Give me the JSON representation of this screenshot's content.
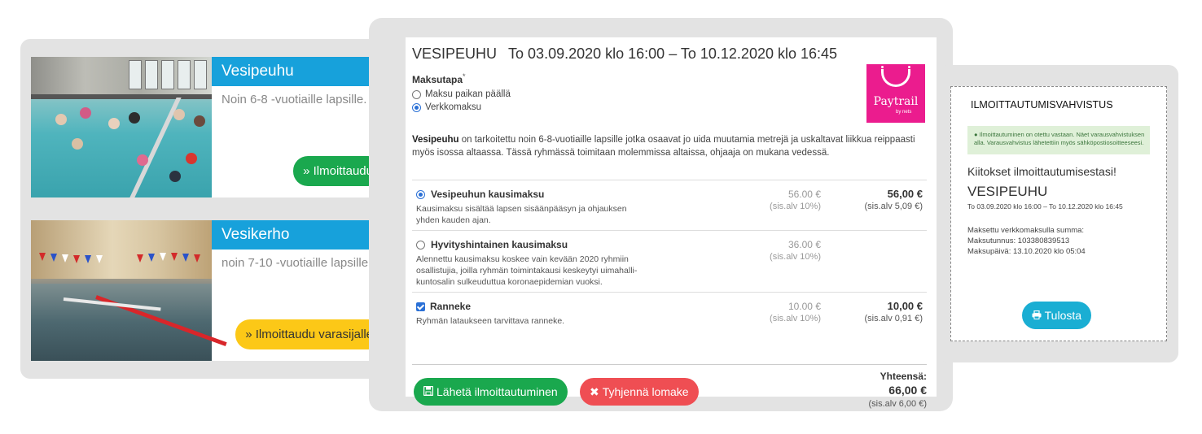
{
  "cards": [
    {
      "title": "Vesipeuhu",
      "description": "Noin 6-8 -vuotiaille lapsille.",
      "button": "» Ilmoittaudu",
      "button_color": "#1aa84e"
    },
    {
      "title": "Vesikerho",
      "description": "noin 7-10 -vuotiaille lapsille.",
      "button": "» Ilmoittaudu varasijalle",
      "button_color": "#fcc817"
    }
  ],
  "form": {
    "title": "VESIPEUHU",
    "dates": "To 03.09.2020 klo 16:00 – To 10.12.2020 klo 16:45",
    "payment_label": "Maksutapa",
    "payment_required_mark": "*",
    "payment_options": [
      {
        "label": "Maksu paikan päällä",
        "selected": false
      },
      {
        "label": "Verkkomaksu",
        "selected": true
      }
    ],
    "paytrail_logo": {
      "name": "Paytrail",
      "by": "by nets",
      "color": "#eb1c8e"
    },
    "intro_bold": "Vesipeuhu",
    "intro_rest": " on tarkoitettu noin 6-8-vuotiaille lapsille jotka osaavat jo uida muutamia metrejä ja uskaltavat liikkua reippaasti myös isossa altaassa. Tässä ryhmässä toimitaan molemmissa altaissa, ohjaaja on mukana vedessä.",
    "items": [
      {
        "name": "Vesipeuhun kausimaksu",
        "control": "radio",
        "checked": true,
        "description": "Kausimaksu sisältää lapsen sisäänpääsyn ja ohjauksen yhden kauden ajan.",
        "unit_price": "56.00 €",
        "unit_vat": "(sis.alv 10%)",
        "total_price": "56,00 €",
        "total_vat": "(sis.alv 5,09 €)"
      },
      {
        "name": "Hyvityshintainen kausimaksu",
        "control": "radio",
        "checked": false,
        "description": "Alennettu kausimaksu koskee vain kevään 2020 ryhmiin osallistujia, joilla ryhmän toimintakausi keskeytyi uimahalli-kuntosalin sulkeuduttua koronaepidemian vuoksi.",
        "unit_price": "36.00 €",
        "unit_vat": "(sis.alv 10%)",
        "total_price": "",
        "total_vat": ""
      },
      {
        "name": "Ranneke",
        "control": "checkbox",
        "checked": true,
        "description": "Ryhmän lataukseen tarvittava ranneke.",
        "unit_price": "10.00 €",
        "unit_vat": "(sis.alv 10%)",
        "total_price": "10,00 €",
        "total_vat": "(sis.alv 0,91 €)"
      }
    ],
    "send_button": "Lähetä ilmoittautuminen",
    "clear_button": "Tyhjennä lomake",
    "total_label": "Yhteensä:",
    "total_value": "66,00 €",
    "total_vat": "(sis.alv 6,00 €)"
  },
  "confirmation": {
    "title": "ILMOITTAUTUMISVAHVISTUS",
    "alert": "Ilmoittautuminen on otettu vastaan. Näet varausvahvistuksen alla. Varausvahvistus lähetettiin myös sähköpostiosoitteeseesi.",
    "thanks": "Kiitokset ilmoittautumisestasi!",
    "name": "VESIPEUHU",
    "dates": "To 03.09.2020 klo 16:00 – To 10.12.2020 klo 16:45",
    "paid_line": "Maksettu verkkomaksulla summa:",
    "payment_id_line": "Maksutunnus: 103380839513",
    "payment_date_line": "Maksupäivä: 13.10.2020 klo 05:04",
    "print_button": "Tulosta"
  }
}
